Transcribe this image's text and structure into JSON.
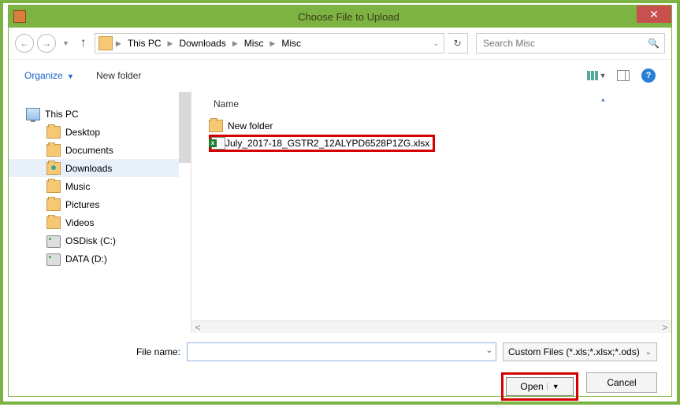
{
  "window": {
    "title": "Choose File to Upload"
  },
  "breadcrumbs": {
    "b0": "This PC",
    "b1": "Downloads",
    "b2": "Misc",
    "b3": "Misc"
  },
  "search": {
    "placeholder": "Search Misc"
  },
  "toolbar": {
    "organize": "Organize",
    "new_folder": "New folder"
  },
  "tree": {
    "root": "This PC",
    "desktop": "Desktop",
    "documents": "Documents",
    "downloads": "Downloads",
    "music": "Music",
    "pictures": "Pictures",
    "videos": "Videos",
    "osdisk": "OSDisk (C:)",
    "data": "DATA (D:)"
  },
  "filelist": {
    "col_name": "Name",
    "folder1": "New folder",
    "file1": "July_2017-18_GSTR2_12ALYPD6528P1ZG.xlsx"
  },
  "footer": {
    "filename_label": "File name:",
    "filename_value": "",
    "filetype": "Custom Files (*.xls;*.xlsx;*.ods)",
    "open": "Open",
    "cancel": "Cancel"
  }
}
